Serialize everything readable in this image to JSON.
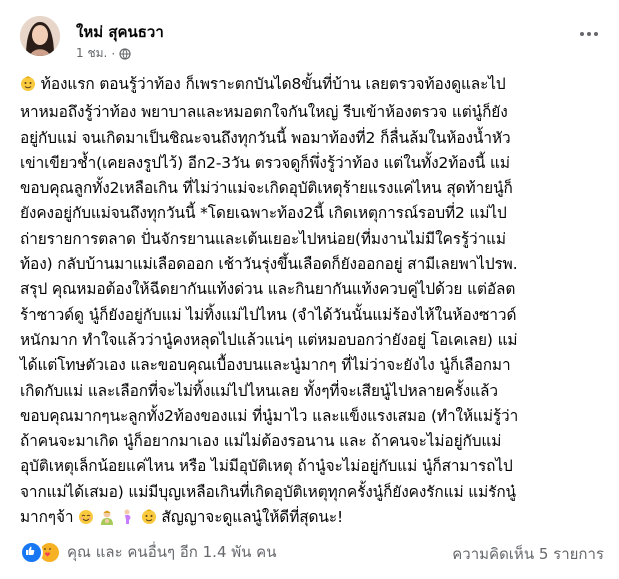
{
  "post": {
    "author": "ใหม่ สุคนธวา",
    "time": "1 ชม.",
    "meta_separator": "·",
    "privacy_icon": "globe-icon",
    "more_icon": "more-horizontal-icon",
    "lines": [
      "ท้องแรก ตอนรู้ว่าท้อง ก็เพราะตกบันได8ขั้นที่บ้าน เลยตรวจท้องดูและไป",
      "หาหมอถึงรู้ว่าท้อง พยาบาลและหมอตกใจกันใหญ่ รีบเข้าห้องตรวจ แต่นู๋ก็ยัง",
      "อยู่กับแม่ จนเกิดมาเป็นชิณะจนถึงทุกวันนี้ พอมาท้องที่2 ก็ลื่นล้มในห้องน้ำหัว",
      "เข่าเขียวช้ำ(เคยลงรูปไว้) อีก2-3วัน ตรวจดูก็พึ่งรู้ว่าท้อง แต่ในทั้ง2ท้องนี้ แม่",
      "ขอบคุณลูกทั้ง2เหลือเกิน ที่ไม่ว่าแม่จะเกิดอุบัติเหตุร้ายแรงแค่ไหน สุดท้ายนู๋ก็",
      "ยังคงอยู่กับแม่จนถึงทุกวันนี้ *โดยเฉพาะท้อง2นี้ เกิดเหตุการณ์รอบที่2 แม่ไป",
      "ถ่ายรายการตลาด ปั่นจักรยานและเต้นเยอะไปหน่อย(ที่มงานไม่มีใครรู้ว่าแม่",
      "ท้อง) กลับบ้านมาแม่เลือดออก เช้าวันรุ่งขึ้นเลือดก็ยังออกอยู่ สามีเลยพาไปรพ.",
      "สรุป คุณหมอต้องให้ฉีดยากันแท้งด่วน และกินยากันแท้งควบคู่ไปด้วย แต่อัลต",
      "ร้าซาวด์ดู นู๋ก็ยังอยู่กับแม่ ไม่ทิ้งแม่ไปไหน (จำได้วันนั้นแม่ร้องไห้ในห้องซาวด์",
      "หนักมาก ทำใจแล้วว่านู๋คงหลุดไปแล้วแน่ๆ แต่หมอบอกว่ายังอยู่ โอเคเลย) แม่",
      "ได้แต่โทษตัวเอง และขอบคุณเบื้องบนและนู๋มากๆ ที่ไม่ว่าจะยังไง นู๋ก็เลือกมา",
      "เกิดกับแม่ และเลือกที่จะไม่ทิ้งแม่ไปไหนเลย ทั้งๆที่จะเสียนู๋ไปหลายครั้งแล้ว",
      "ขอบคุณมากๆนะลูกทั้ง2ท้องของแม่ ที่นู๋มาไว และแข็งแรงเสมอ  (ทำให้แม่รู้ว่า",
      "ถ้าคนจะมาเกิด นู๋ก็อยากมาเอง แม่ไม่ต้องรอนาน และ ถ้าคนจะไม่อยู่กับแม่",
      "อุบัติเหตุเล็กน้อยแค่ไหน หรือ ไม่มีอุบัติเหตุ ถ้านู๋จะไม่อยู่กับแม่ นู๋ก็สามารถไป",
      "จากแม่ได้เสมอ) แม่มีบุญเหลือเกินที่เกิดอุบัติเหตุทุกครั้งนู๋ก็ยังคงรักแม่ แม่รักนู๋",
      "มากๆจ้า",
      "สัญญาจะดูแลนู๋ให้ดีที่สุดนะ!"
    ],
    "emoji": {
      "baby_face": "baby-face-emoji",
      "smiling_face": "smiling-face-emoji",
      "mother": "mother-with-baby-emoji",
      "pregnant": "pregnant-woman-emoji"
    }
  },
  "footer": {
    "reaction_icons": [
      "like-icon",
      "care-icon"
    ],
    "reaction_summary": "คุณ และ คนอื่นๆ อีก 1.4 พัน คน",
    "comments": "ความคิดเห็น 5 รายการ"
  },
  "colors": {
    "text": "#050505",
    "secondary": "#65676b",
    "like_blue": "#1877f2",
    "care_yellow": "#f7b125"
  }
}
